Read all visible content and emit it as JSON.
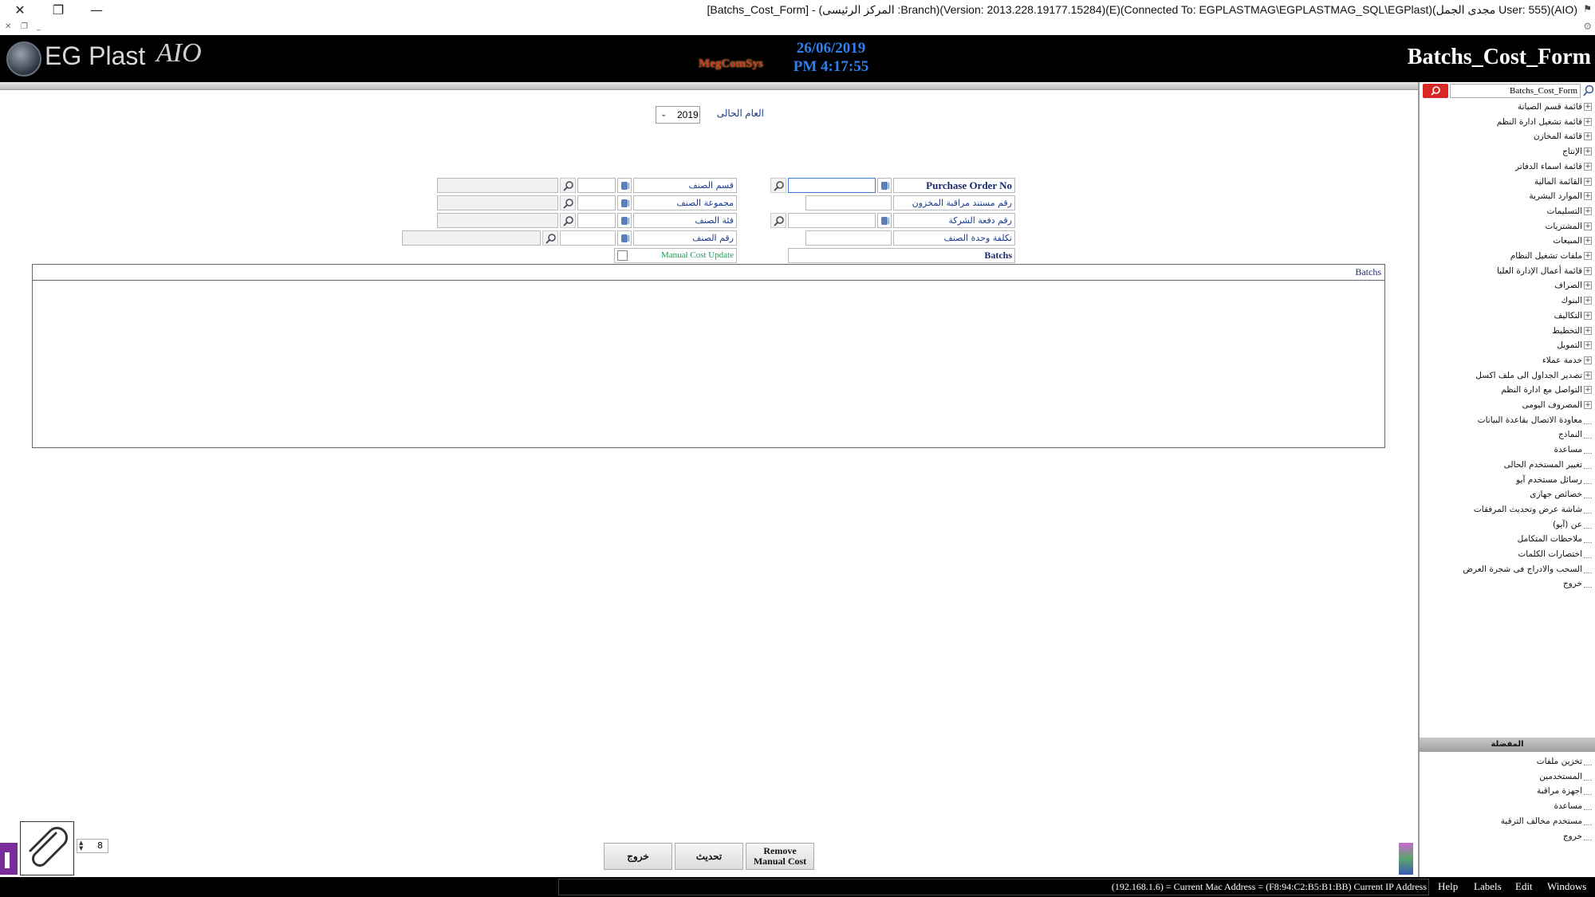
{
  "window": {
    "title": "[Batchs_Cost_Form] - (المركز الرئيسى :Branch)(Version: 2013.228.19177.15284)(E)(Connected To: EGPLASTMAG\\EGPLASTMAG_SQL\\EGPlast)(مجدى الجمل User: 555)(AIO)",
    "close_glyph": "✕",
    "restore_glyph": "❐",
    "minimize_glyph": "—"
  },
  "header": {
    "logo_text": "EG Plast",
    "logo_suffix": "AIO",
    "brand_small": "MegComSys",
    "date": "26/06/2019",
    "time": "PM 4:17:55",
    "form_title": "Batchs_Cost_Form"
  },
  "year": {
    "label": "العام الحالى",
    "value": "2019"
  },
  "fields_right": {
    "purchase_order_no": "Purchase Order No",
    "stock_doc_no": "رقم مستند مراقبة المخزون",
    "company_batch_no": "رقم دفعة الشركة",
    "item_unit_cost": "تكلفة وحدة الصنف",
    "batchs": "Batchs"
  },
  "fields_left": {
    "item_section": "قسم الصنف",
    "item_group": "مجموعة الصنف",
    "item_category": "فئة الصنف",
    "item_no": "رقم الصنف",
    "manual_cost_update": "Manual Cost Update"
  },
  "batchs_panel": {
    "header": "Batchs"
  },
  "buttons": {
    "exit": "خروج",
    "refresh": "تحديث",
    "remove_line1": "Remove",
    "remove_line2": "Manual Cost"
  },
  "attachment": {
    "count": "8"
  },
  "statusbar": {
    "info": "(192.168.1.6) = Current Mac Address = (F8:94:C2:B5:B1:BB) Current IP Address",
    "menu": [
      "Help",
      "Labels",
      "Edit",
      "Windows"
    ]
  },
  "sidebar": {
    "search_value": "Batchs_Cost_Form",
    "tree": [
      "قائمة قسم الصيانة",
      "قائمة تشغيل ادارة النظم",
      "قائمة المخازن",
      "الإنتاج",
      "قائمة اسماء الدفاتر",
      "القائمة المالية",
      "الموارد البشرية",
      "التسليمات",
      "المشتريات",
      "المبيعات",
      "ملفات تشغيل النظام",
      "قائمة أعمال الإدارة العليا",
      "الصراف",
      "البنوك",
      "التكاليف",
      "التخطيط",
      "التمويل",
      "خدمة عملاء",
      "تصدير الجداول الى ملف اكسل",
      "التواصل مع ادارة النظم",
      "المصروف اليومى",
      "معاودة الاتصال بقاعدة البيانات",
      "النماذج",
      "مساعدة",
      "تغيير المستخدم الحالى",
      "رسائل مستخدم آيو",
      "خصائص جهازى",
      "شاشة عرض وتحديث المرفقات",
      "عن (آيو)",
      "ملاحظات المتكامل",
      "اختصارات الكلمات",
      "السحب والادراج فى شجرة العرض",
      "خروج"
    ],
    "tree_expandable_count": 21,
    "section_title": "المفضلة",
    "favorites": [
      "تخزين ملفات",
      "المستخدمين",
      "اجهزة مراقبة",
      "مساعدة",
      "مستخدم مخالف الترقية",
      "خروج"
    ]
  }
}
